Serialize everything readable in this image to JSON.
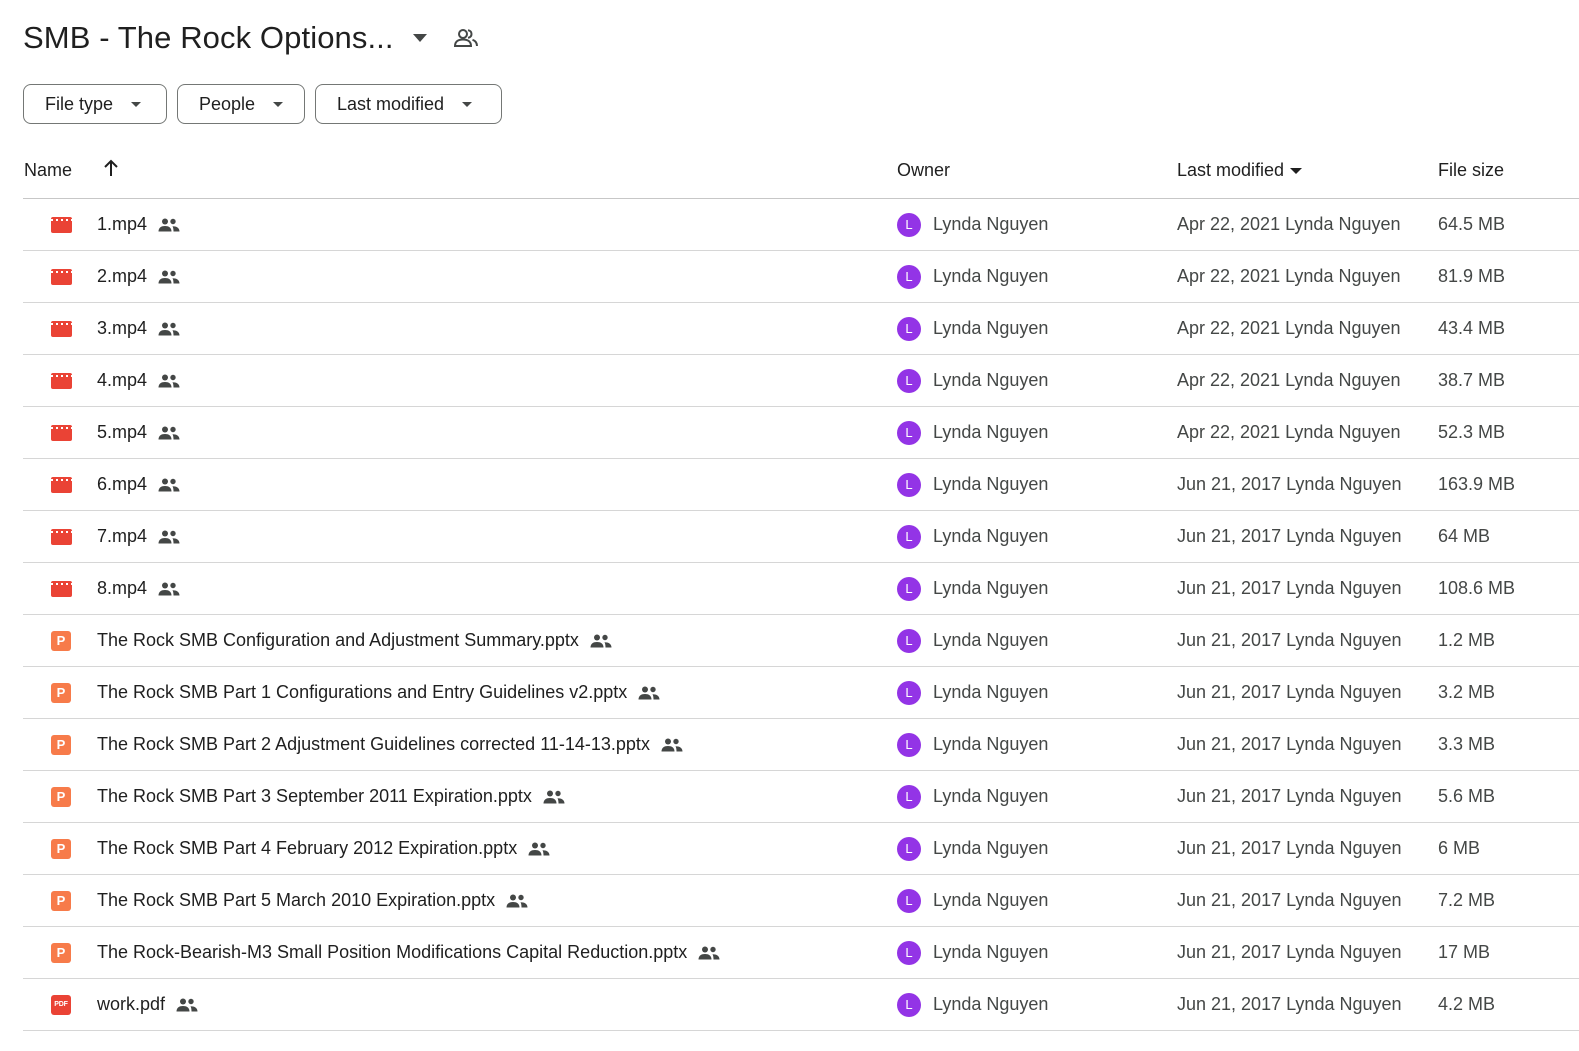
{
  "header": {
    "title": "SMB - The Rock Options...",
    "caret_icon": "arrow-drop-down-icon",
    "shared_icon": "shared-folder-people-icon"
  },
  "filters": {
    "file_type": "File type",
    "people": "People",
    "last_modified": "Last modified"
  },
  "columns": {
    "name": "Name",
    "owner": "Owner",
    "last_modified": "Last modified",
    "file_size": "File size"
  },
  "colors": {
    "avatar": "#9334e6",
    "video": "#ea4335",
    "slides": "#f77b4a",
    "pdf": "#ea4335"
  },
  "files": [
    {
      "name": "1.mp4",
      "type": "video",
      "owner": "Lynda Nguyen",
      "owner_initial": "L",
      "modified": "Apr 22, 2021 Lynda Nguyen",
      "size": "64.5 MB",
      "shared": true
    },
    {
      "name": "2.mp4",
      "type": "video",
      "owner": "Lynda Nguyen",
      "owner_initial": "L",
      "modified": "Apr 22, 2021 Lynda Nguyen",
      "size": "81.9 MB",
      "shared": true
    },
    {
      "name": "3.mp4",
      "type": "video",
      "owner": "Lynda Nguyen",
      "owner_initial": "L",
      "modified": "Apr 22, 2021 Lynda Nguyen",
      "size": "43.4 MB",
      "shared": true
    },
    {
      "name": "4.mp4",
      "type": "video",
      "owner": "Lynda Nguyen",
      "owner_initial": "L",
      "modified": "Apr 22, 2021 Lynda Nguyen",
      "size": "38.7 MB",
      "shared": true
    },
    {
      "name": "5.mp4",
      "type": "video",
      "owner": "Lynda Nguyen",
      "owner_initial": "L",
      "modified": "Apr 22, 2021 Lynda Nguyen",
      "size": "52.3 MB",
      "shared": true
    },
    {
      "name": "6.mp4",
      "type": "video",
      "owner": "Lynda Nguyen",
      "owner_initial": "L",
      "modified": "Jun 21, 2017 Lynda Nguyen",
      "size": "163.9 MB",
      "shared": true
    },
    {
      "name": "7.mp4",
      "type": "video",
      "owner": "Lynda Nguyen",
      "owner_initial": "L",
      "modified": "Jun 21, 2017 Lynda Nguyen",
      "size": "64 MB",
      "shared": true
    },
    {
      "name": "8.mp4",
      "type": "video",
      "owner": "Lynda Nguyen",
      "owner_initial": "L",
      "modified": "Jun 21, 2017 Lynda Nguyen",
      "size": "108.6 MB",
      "shared": true
    },
    {
      "name": "The Rock SMB Configuration and Adjustment Summary.pptx",
      "type": "slides",
      "owner": "Lynda Nguyen",
      "owner_initial": "L",
      "modified": "Jun 21, 2017 Lynda Nguyen",
      "size": "1.2 MB",
      "shared": true
    },
    {
      "name": "The Rock SMB Part 1 Configurations and Entry Guidelines v2.pptx",
      "type": "slides",
      "owner": "Lynda Nguyen",
      "owner_initial": "L",
      "modified": "Jun 21, 2017 Lynda Nguyen",
      "size": "3.2 MB",
      "shared": true
    },
    {
      "name": "The Rock SMB Part 2 Adjustment Guidelines corrected 11-14-13.pptx",
      "type": "slides",
      "owner": "Lynda Nguyen",
      "owner_initial": "L",
      "modified": "Jun 21, 2017 Lynda Nguyen",
      "size": "3.3 MB",
      "shared": true
    },
    {
      "name": "The Rock SMB Part 3 September 2011 Expiration.pptx",
      "type": "slides",
      "owner": "Lynda Nguyen",
      "owner_initial": "L",
      "modified": "Jun 21, 2017 Lynda Nguyen",
      "size": "5.6 MB",
      "shared": true
    },
    {
      "name": "The Rock SMB Part 4 February 2012 Expiration.pptx",
      "type": "slides",
      "owner": "Lynda Nguyen",
      "owner_initial": "L",
      "modified": "Jun 21, 2017 Lynda Nguyen",
      "size": "6 MB",
      "shared": true
    },
    {
      "name": "The Rock SMB Part 5 March 2010 Expiration.pptx",
      "type": "slides",
      "owner": "Lynda Nguyen",
      "owner_initial": "L",
      "modified": "Jun 21, 2017 Lynda Nguyen",
      "size": "7.2 MB",
      "shared": true
    },
    {
      "name": "The Rock-Bearish-M3 Small Position Modifications Capital Reduction.pptx",
      "type": "slides",
      "owner": "Lynda Nguyen",
      "owner_initial": "L",
      "modified": "Jun 21, 2017 Lynda Nguyen",
      "size": "17 MB",
      "shared": true
    },
    {
      "name": "work.pdf",
      "type": "pdf",
      "owner": "Lynda Nguyen",
      "owner_initial": "L",
      "modified": "Jun 21, 2017 Lynda Nguyen",
      "size": "4.2 MB",
      "shared": true
    }
  ]
}
